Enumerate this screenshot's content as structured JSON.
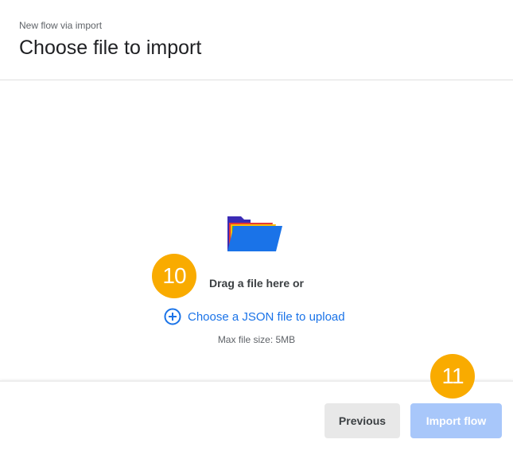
{
  "header": {
    "subtitle": "New flow via import",
    "title": "Choose file to import"
  },
  "dropzone": {
    "icon": "folder-icon",
    "drag_text": "Drag a file here or",
    "choose_icon": "add-circle-icon",
    "choose_label": "Choose a JSON file to upload",
    "max_size": "Max file size: 5MB"
  },
  "badges": {
    "step_a": "10",
    "step_b": "11"
  },
  "footer": {
    "previous_label": "Previous",
    "import_label": "Import flow"
  },
  "colors": {
    "accent": "#1a73e8",
    "badge": "#f9ab00",
    "import_disabled": "#a8c7fa"
  }
}
